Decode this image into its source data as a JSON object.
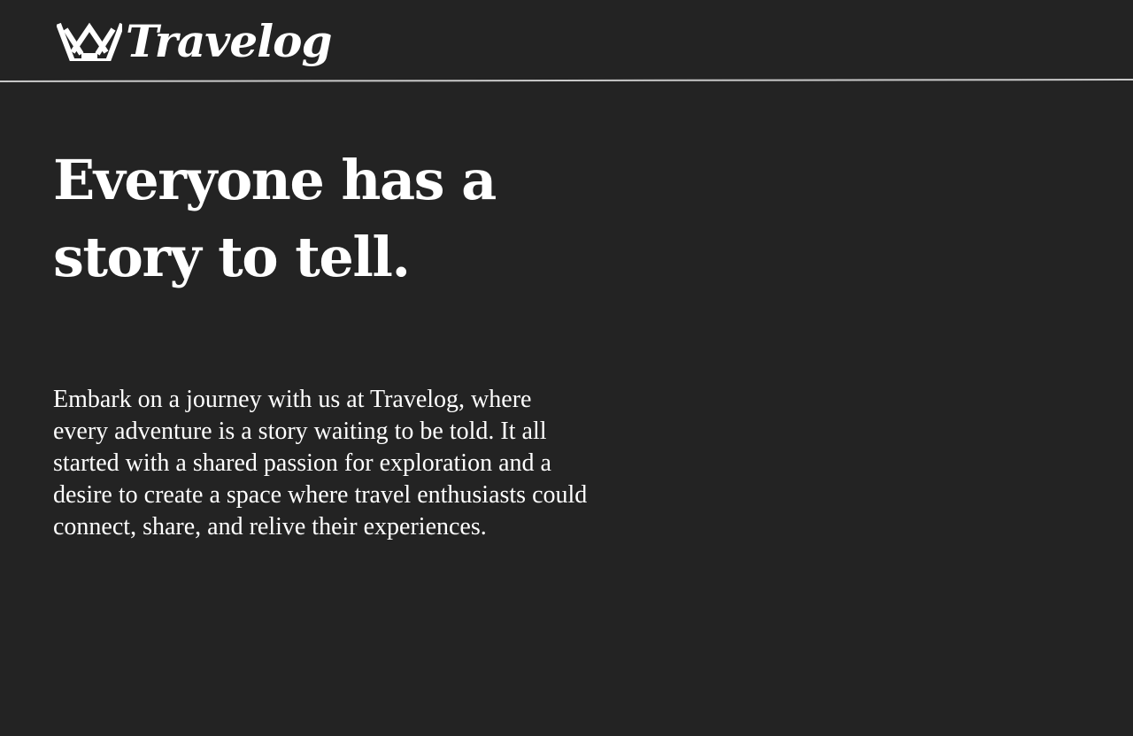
{
  "header": {
    "brand_name": "Travelog",
    "brand_icon": "crown-icon"
  },
  "hero": {
    "title_lines": [
      "Everyone has a",
      "story to tell."
    ]
  },
  "intro": {
    "lines": [
      "Embark on a journey with us at Travelog, where",
      "every adventure is a story waiting to be told. It all",
      "started with a shared passion for exploration and a",
      "desire to create a space where travel enthusiasts could",
      "connect, share, and relive their experiences."
    ]
  },
  "colors": {
    "background": "#232323",
    "text": "#ffffff",
    "divider": "#c9c9c9"
  }
}
